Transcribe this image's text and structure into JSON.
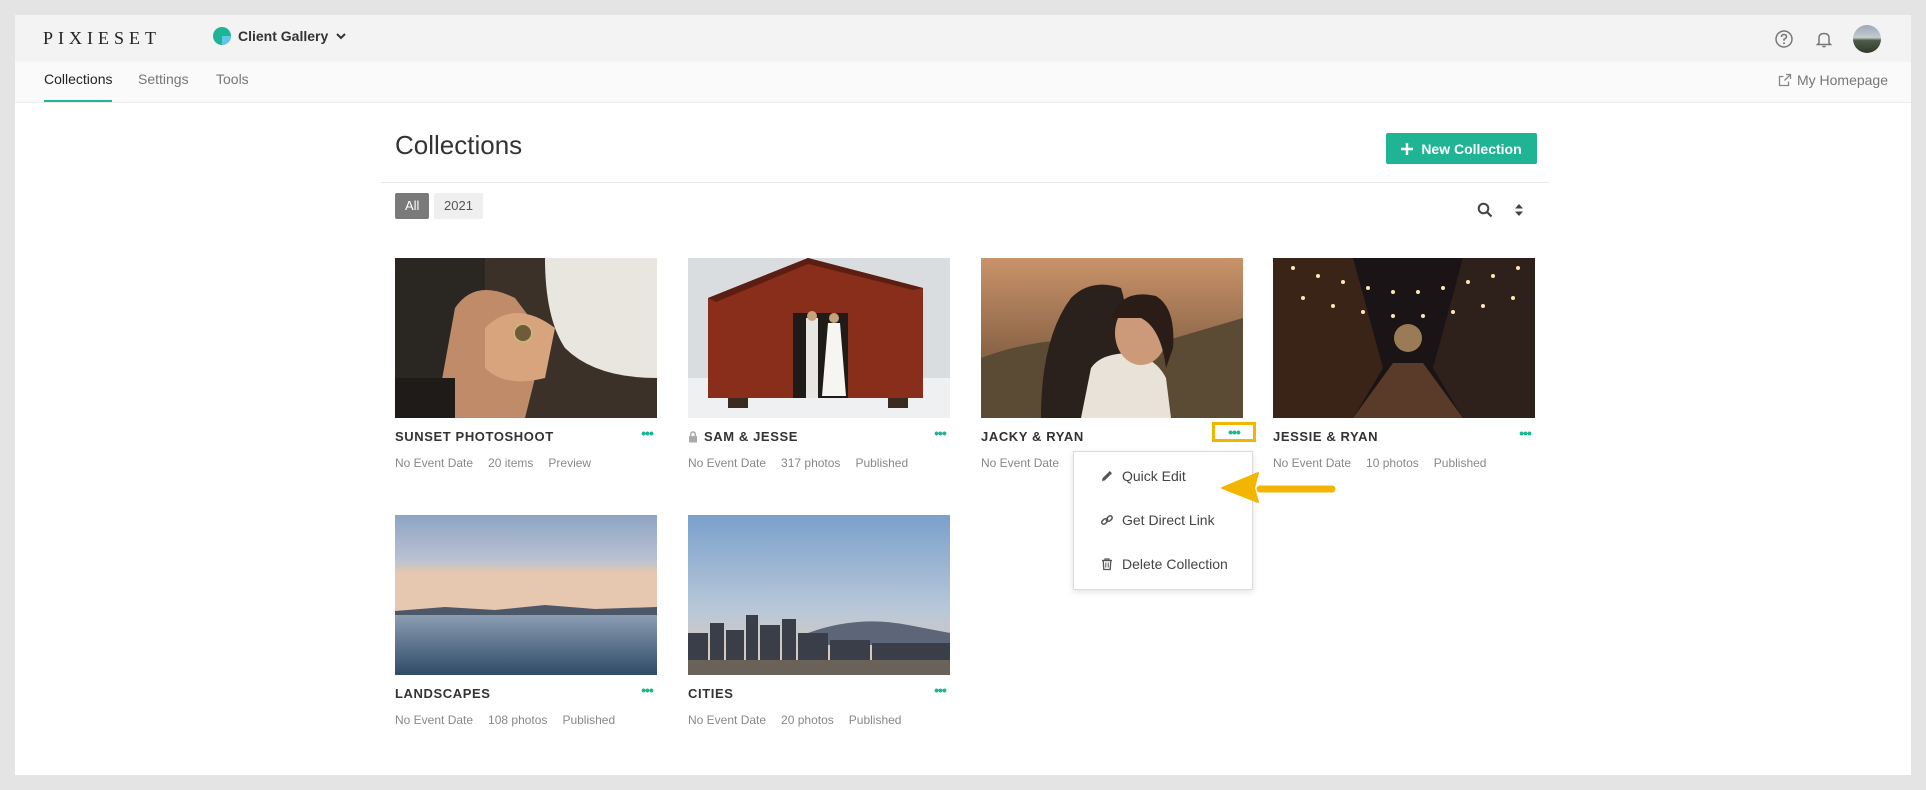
{
  "brand": {
    "logo": "PIXIESET"
  },
  "header": {
    "app_switch_label": "Client Gallery"
  },
  "nav": {
    "tabs": [
      "Collections",
      "Settings",
      "Tools"
    ],
    "active_tab": "Collections",
    "homepage_link": "My Homepage"
  },
  "page": {
    "title": "Collections",
    "new_button": "New Collection",
    "filters": [
      "All",
      "2021"
    ],
    "active_filter": "All"
  },
  "collections": [
    {
      "title": "SUNSET PHOTOSHOOT",
      "date": "No Event Date",
      "count": "20 items",
      "status": "Preview",
      "locked": false,
      "image": "cufflinks-photo"
    },
    {
      "title": "SAM & JESSE",
      "date": "No Event Date",
      "count": "317 photos",
      "status": "Published",
      "locked": true,
      "image": "barn-couple-photo"
    },
    {
      "title": "JACKY & RYAN",
      "date": "No Event Date",
      "count": "",
      "status": "",
      "locked": false,
      "image": "couple-sunset-photo"
    },
    {
      "title": "JESSIE & RYAN",
      "date": "No Event Date",
      "count": "10 photos",
      "status": "Published",
      "locked": false,
      "image": "string-lights-alley-photo"
    },
    {
      "title": "LANDSCAPES",
      "date": "No Event Date",
      "count": "108 photos",
      "status": "Published",
      "locked": false,
      "image": "lake-sunset-photo"
    },
    {
      "title": "CITIES",
      "date": "No Event Date",
      "count": "20 photos",
      "status": "Published",
      "locked": false,
      "image": "city-skyline-photo"
    }
  ],
  "more_menu": {
    "items": [
      {
        "label": "Quick Edit",
        "icon": "pencil-icon"
      },
      {
        "label": "Get Direct Link",
        "icon": "link-icon"
      },
      {
        "label": "Delete Collection",
        "icon": "trash-icon"
      }
    ]
  },
  "colors": {
    "accent": "#1fb494",
    "highlight": "#f3b600"
  }
}
